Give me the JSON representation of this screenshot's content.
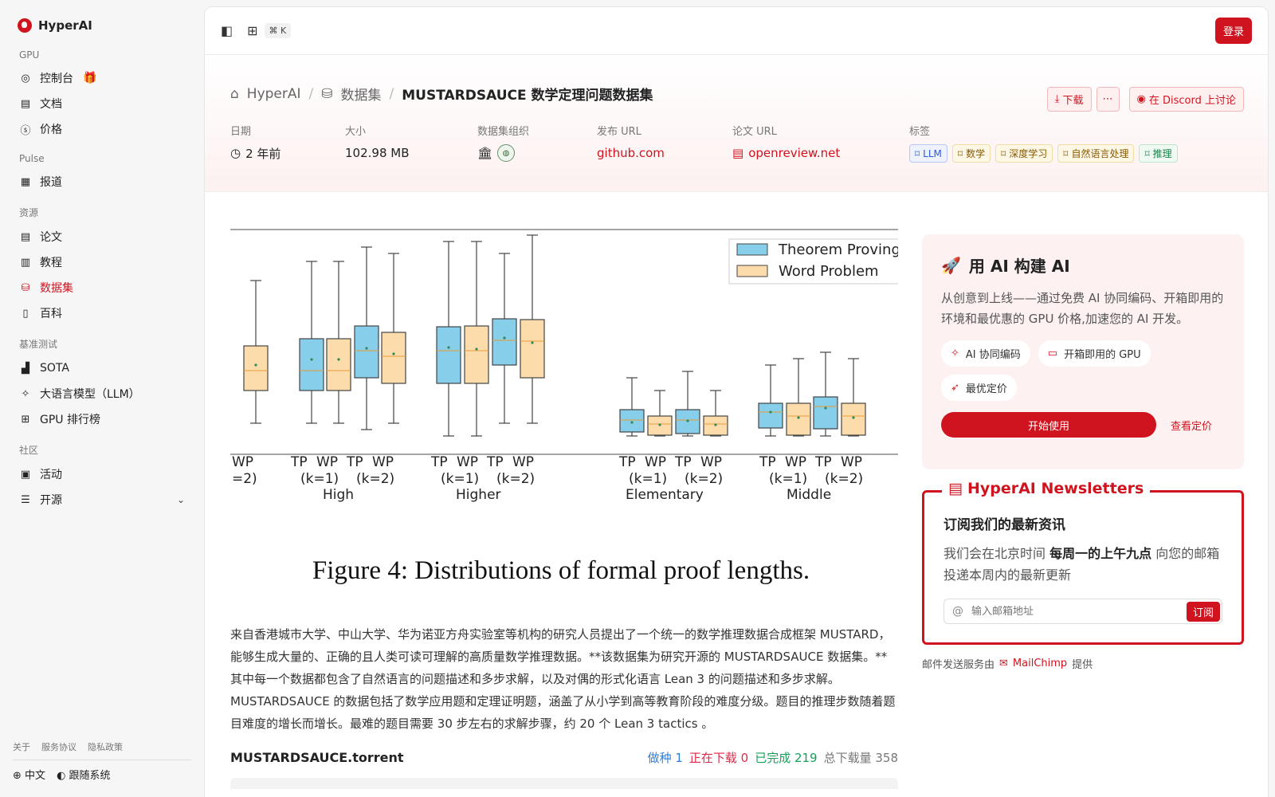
{
  "brand": {
    "name": "HyperAI"
  },
  "sidebar": {
    "groups": [
      {
        "title": "GPU",
        "items": [
          {
            "label": "控制台"
          },
          {
            "label": "文档"
          },
          {
            "label": "价格"
          }
        ]
      },
      {
        "title": "Pulse",
        "items": [
          {
            "label": "报道"
          }
        ]
      },
      {
        "title": "资源",
        "items": [
          {
            "label": "论文"
          },
          {
            "label": "教程"
          },
          {
            "label": "数据集"
          },
          {
            "label": "百科"
          }
        ]
      },
      {
        "title": "基准测试",
        "items": [
          {
            "label": "SOTA"
          },
          {
            "label": "大语言模型（LLM）"
          },
          {
            "label": "GPU 排行榜"
          }
        ]
      },
      {
        "title": "社区",
        "items": [
          {
            "label": "活动"
          },
          {
            "label": "开源"
          }
        ]
      }
    ],
    "footer_links": [
      "关于",
      "服务协议",
      "隐私政策"
    ],
    "language": "中文",
    "theme": "跟随系统"
  },
  "topbar": {
    "shortcut": "⌘ K",
    "login_label": "登录"
  },
  "breadcrumb": {
    "home": "HyperAI",
    "section": "数据集",
    "current": "MUSTARDSAUCE 数学定理问题数据集"
  },
  "actions": {
    "download": "下载",
    "discord": "在 Discord 上讨论"
  },
  "meta": {
    "date_label": "日期",
    "date_value": "2 年前",
    "size_label": "大小",
    "size_value": "102.98 MB",
    "org_label": "数据集组织",
    "release_label": "发布 URL",
    "release_value": "github.com",
    "paper_label": "论文 URL",
    "paper_value": "openreview.net",
    "tags_label": "标签",
    "tags": [
      "LLM",
      "数学",
      "深度学习",
      "自然语言处理",
      "推理"
    ]
  },
  "figure": {
    "legend": [
      "Theorem Proving",
      "Word Problem"
    ],
    "caption": "Figure 4: Distributions of formal proof lengths.",
    "tick_labels": {
      "g0": [
        "WP",
        "=2)"
      ],
      "g1": [
        "TP",
        "WP",
        "TP",
        "WP",
        "(k=1)",
        "(k=2)",
        "High"
      ],
      "g2": [
        "TP",
        "WP",
        "TP",
        "WP",
        "(k=1)",
        "(k=2)",
        "Higher"
      ],
      "g3": [
        "TP",
        "WP",
        "TP",
        "WP",
        "(k=1)",
        "(k=2)",
        "Elementary"
      ],
      "g4": [
        "TP",
        "WP",
        "TP",
        "WP",
        "(k=1)",
        "(k=2)",
        "Middle"
      ]
    },
    "colors": {
      "tp": "#87ceeb",
      "wp": "#fcdcab",
      "median": "#e79b3a",
      "mean": "#2e8b57"
    }
  },
  "description": "来自香港城市大学、中山大学、华为诺亚方舟实验室等机构的研究人员提出了一个统一的数学推理数据合成框架 MUSTARD，能够生成大量的、正确的且人类可读可理解的高质量数学推理数据。**该数据集为研究开源的 MUSTARDSAUCE 数据集。**其中每一个数据都包含了自然语言的问题描述和多步求解，以及对偶的形式化语言 Lean 3 的问题描述和多步求解。 MUSTARDSAUCE 的数据包括了数学应用题和定理证明题，涵盖了从小学到高等教育阶段的难度分级。题目的推理步数随着题目难度的增长而增长。最难的题目需要 30 步左右的求解步骤，约 20 个 Lean 3 tactics 。",
  "torrent": {
    "name": "MUSTARDSAUCE.torrent",
    "seeding": "做种 1",
    "downloading": "正在下载 0",
    "completed": "已完成 219",
    "total": "总下载量 358"
  },
  "promo": {
    "title": "用 AI 构建 AI",
    "description": "从创意到上线——通过免费 AI 协同编码、开箱即用的环境和最优惠的 GPU 价格,加速您的 AI 开发。",
    "chips": [
      "AI 协同编码",
      "开箱即用的 GPU",
      "最优定价"
    ],
    "start": "开始使用",
    "pricing": "查看定价"
  },
  "newsletter": {
    "legend": "HyperAI Newsletters",
    "title": "订阅我们的最新资讯",
    "desc_pre": "我们会在北京时间 ",
    "desc_bold": "每周一的上午九点",
    "desc_post": " 向您的邮箱投递本周内的最新更新",
    "placeholder": "输入邮箱地址",
    "subscribe": "订阅",
    "mail_pre": "邮件发送服务由",
    "mail_brand": "MailChimp",
    "mail_post": "提供"
  },
  "colors": {
    "accent": "#d0141f"
  }
}
